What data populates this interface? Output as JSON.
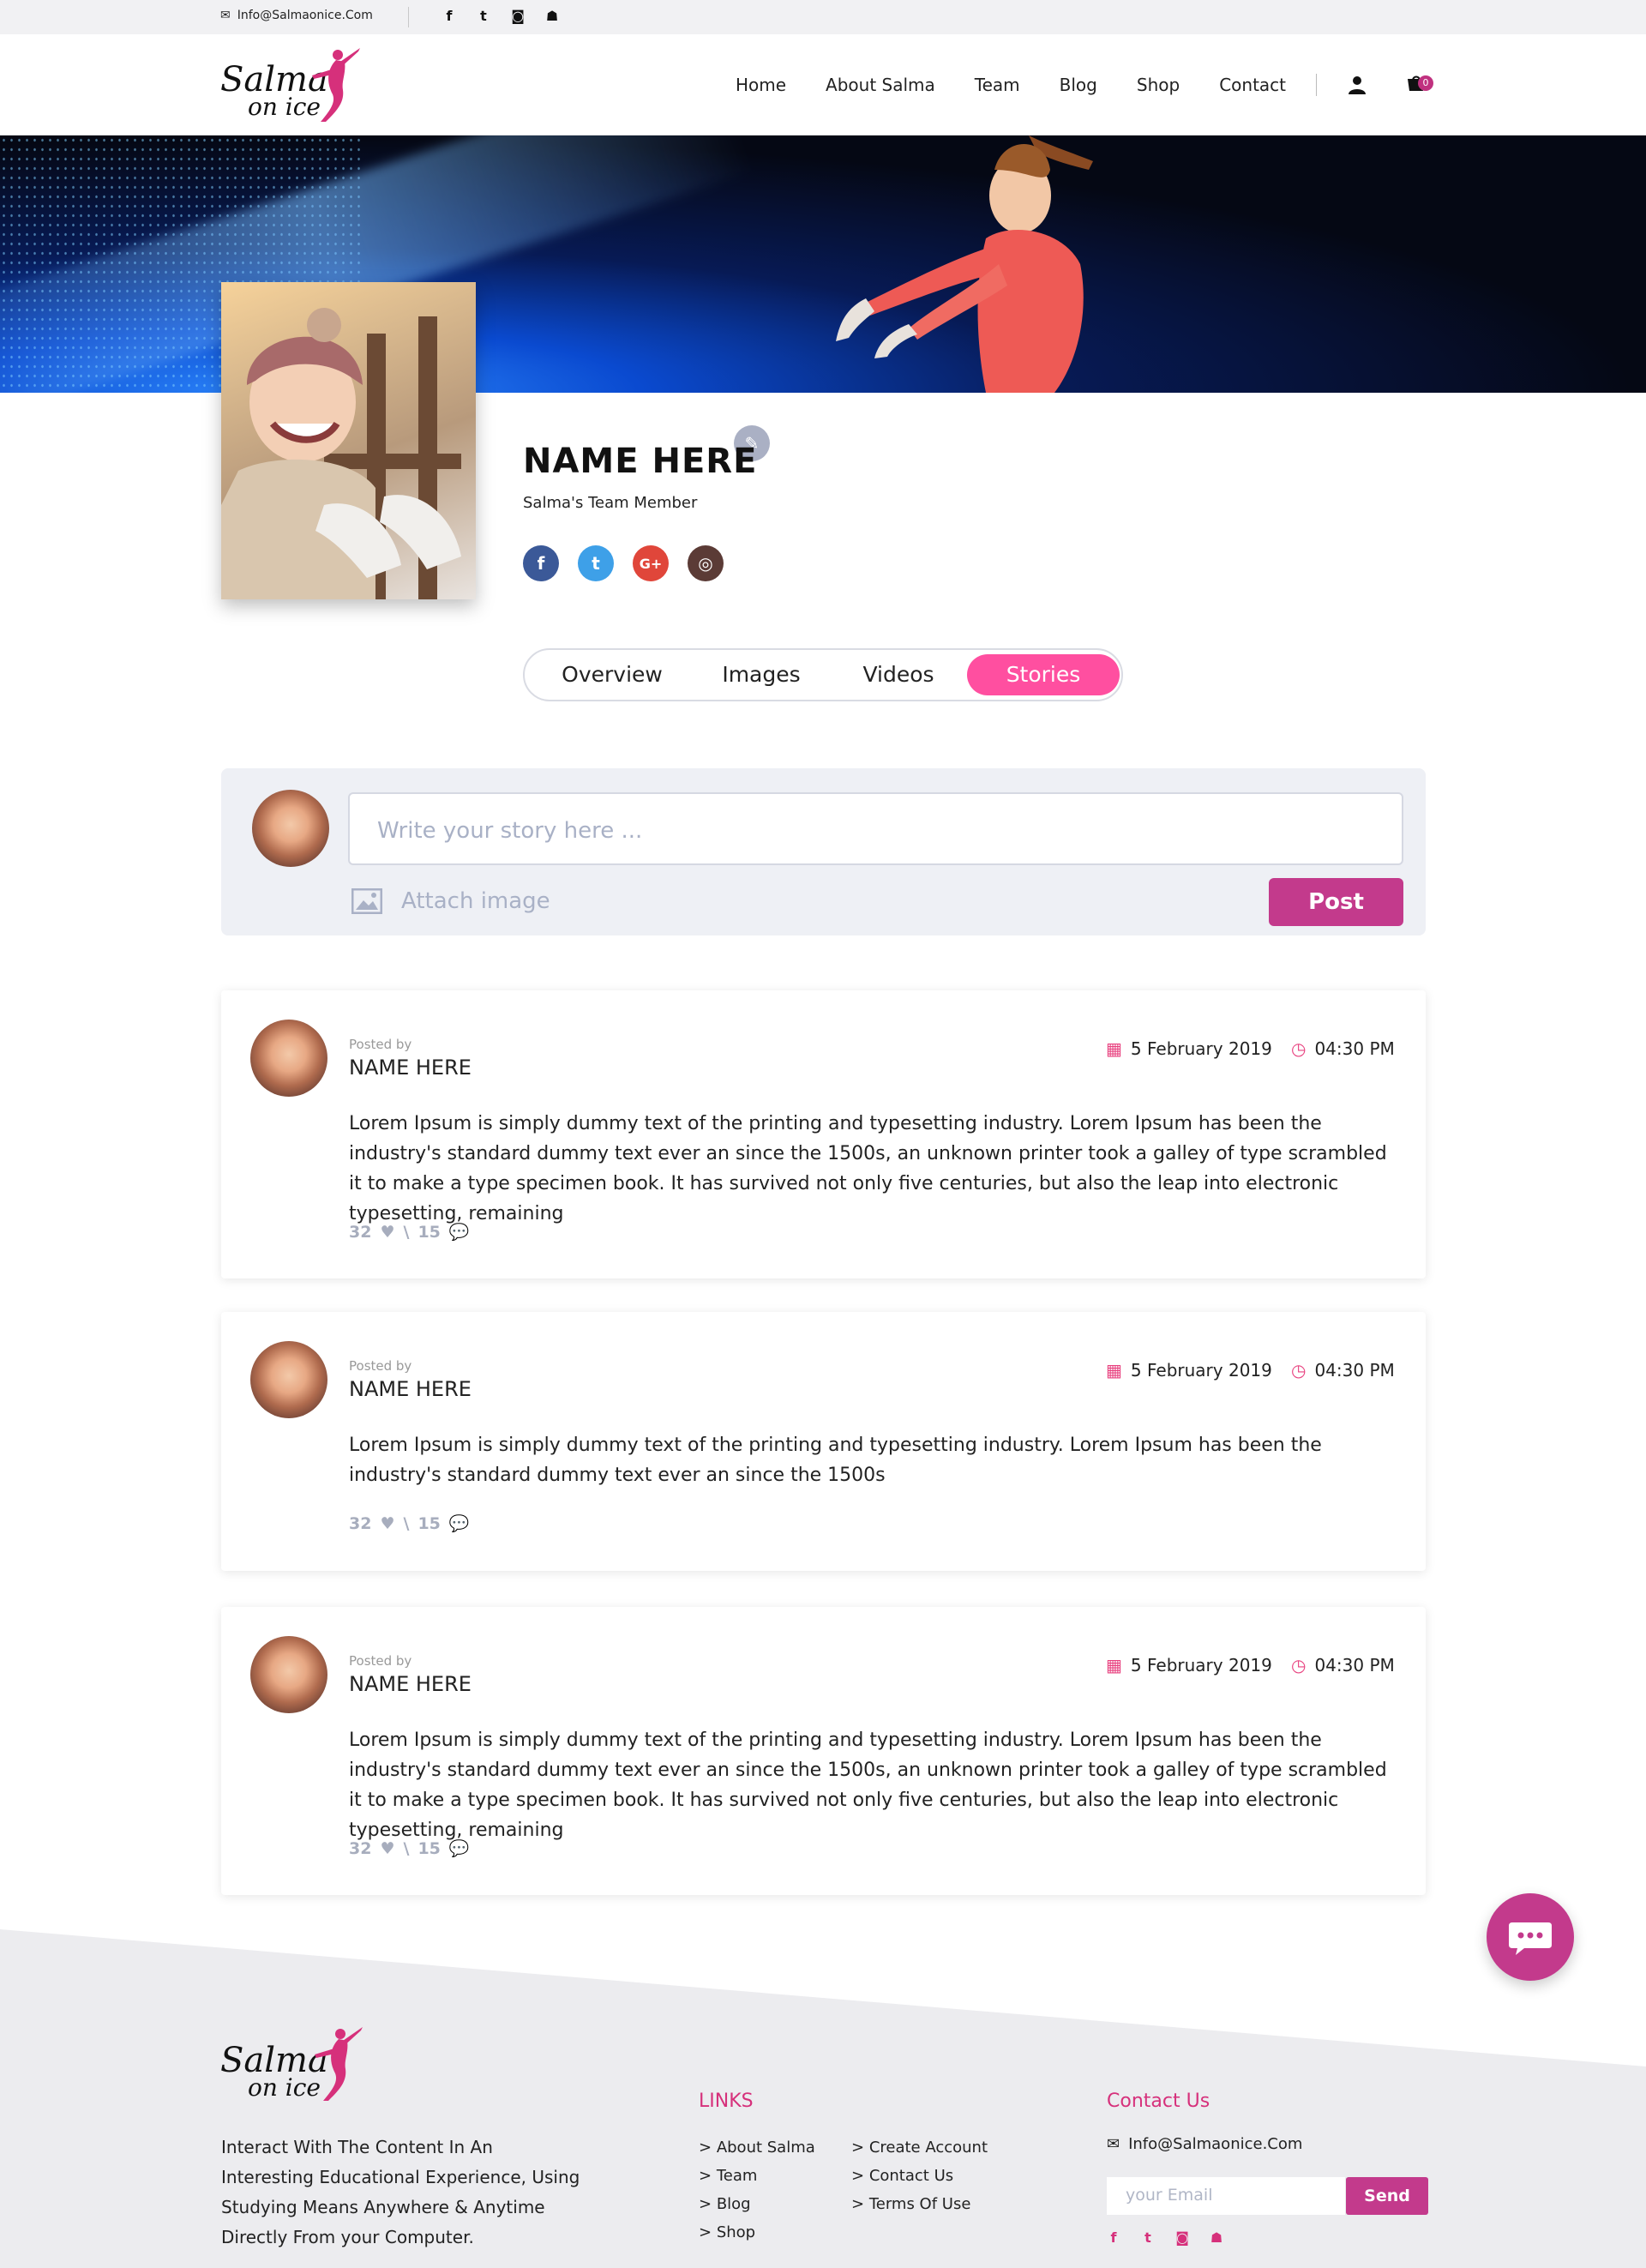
{
  "topbar": {
    "email": "Info@Salmaonice.Com",
    "social": [
      "f",
      "t",
      "◙",
      "☗"
    ]
  },
  "header": {
    "logo_line1": "Salma",
    "logo_line2": "on ice",
    "nav": [
      "Home",
      "About Salma",
      "Team",
      "Blog",
      "Shop",
      "Contact"
    ],
    "cart_count": "0"
  },
  "profile": {
    "name": "NAME HERE",
    "role": "Salma's Team Member",
    "edit_icon": "✎",
    "social": [
      "f",
      "t",
      "G+",
      "◎"
    ]
  },
  "tabs": [
    {
      "label": "Overview",
      "active": false
    },
    {
      "label": "Images",
      "active": false
    },
    {
      "label": "Videos",
      "active": false
    },
    {
      "label": "Stories",
      "active": true
    }
  ],
  "composer": {
    "placeholder": "Write your story here ...",
    "attach_label": "Attach image",
    "post_label": "Post"
  },
  "stories": [
    {
      "posted_by": "Posted by",
      "name": "NAME HERE",
      "date": "5 February 2019",
      "time": "04:30 PM",
      "text": "Lorem Ipsum is simply dummy text of the printing and typesetting industry. Lorem Ipsum has been the industry's standard dummy text ever an since the 1500s, an unknown printer took a galley of type scrambled it to make a type specimen book. It has survived not only  five centuries, but also the leap into electronic typesetting, remaining",
      "likes": "32",
      "comments": "15"
    },
    {
      "posted_by": "Posted by",
      "name": "NAME HERE",
      "date": "5 February 2019",
      "time": "04:30 PM",
      "text": "Lorem Ipsum is simply dummy text of the printing and typesetting industry. Lorem Ipsum has been the industry's standard dummy text ever an since the 1500s",
      "likes": "32",
      "comments": "15"
    },
    {
      "posted_by": "Posted by",
      "name": "NAME HERE",
      "date": "5 February 2019",
      "time": "04:30 PM",
      "text": "Lorem Ipsum is simply dummy text of the printing and typesetting industry. Lorem Ipsum has been the industry's standard dummy text ever an since the 1500s, an unknown printer took a galley of type scrambled it to make a type specimen book. It has survived not only  five centuries, but also the leap into electronic typesetting, remaining",
      "likes": "32",
      "comments": "15"
    }
  ],
  "separator": "\\",
  "footer": {
    "description": "Interact With The Content In An Interesting Educational Experience, Using Studying Means Anywhere & Anytime Directly From your Computer.",
    "links_title": "LINKS",
    "links_col1": [
      "About Salma",
      "Team",
      "Blog",
      "Shop"
    ],
    "links_col2": [
      "Create Account",
      "Contact Us",
      "Terms Of Use"
    ],
    "contact_title": "Contact Us",
    "email": "Info@Salmaonice.Com",
    "email_placeholder": "your Email",
    "send_label": "Send"
  },
  "colors": {
    "accent": "#c33a8c",
    "tab_active": "#ff4fa0",
    "pink_text": "#d6307b",
    "facebook": "#3b5998",
    "twitter": "#3ea0e8",
    "google": "#e0463a",
    "instagram": "#5b3b36"
  }
}
